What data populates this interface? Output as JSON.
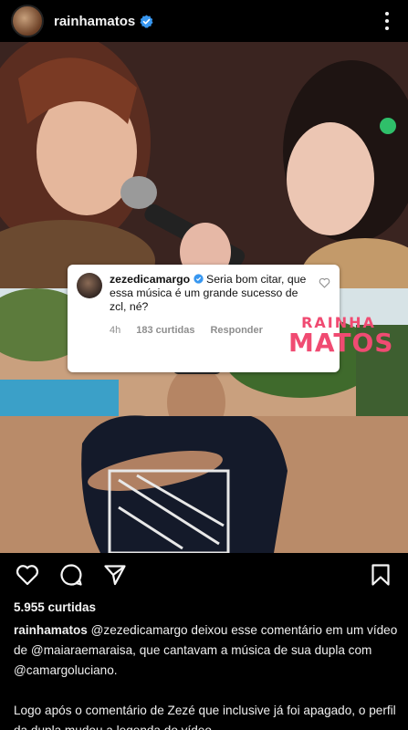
{
  "header": {
    "username": "rainhamatos"
  },
  "comment": {
    "username": "zezedicamargo",
    "text": "Seria bom citar, que essa música é um grande sucesso de zcl, né?",
    "time": "4h",
    "likes": "183 curtidas",
    "reply": "Responder"
  },
  "watermark": {
    "line1": "RAINHA",
    "line2": "MATOS"
  },
  "post": {
    "likes": "5.955 curtidas",
    "caption_user": "rainhamatos",
    "caption_p1": "@zezedicamargo deixou esse comentário em um vídeo de @maiaraemaraisa, que cantavam a música de sua dupla com @camargoluciano.",
    "caption_p2": "Logo após o comentário de Zezé que inclusive já foi apagado, o perfil da dupla mudou a legenda do vídeo."
  },
  "colors": {
    "verified": "#3897f0",
    "watermark": "#f04b72"
  },
  "icons": [
    "heart-icon",
    "comment-icon",
    "share-icon",
    "bookmark-icon",
    "verified-icon",
    "more-icon"
  ]
}
